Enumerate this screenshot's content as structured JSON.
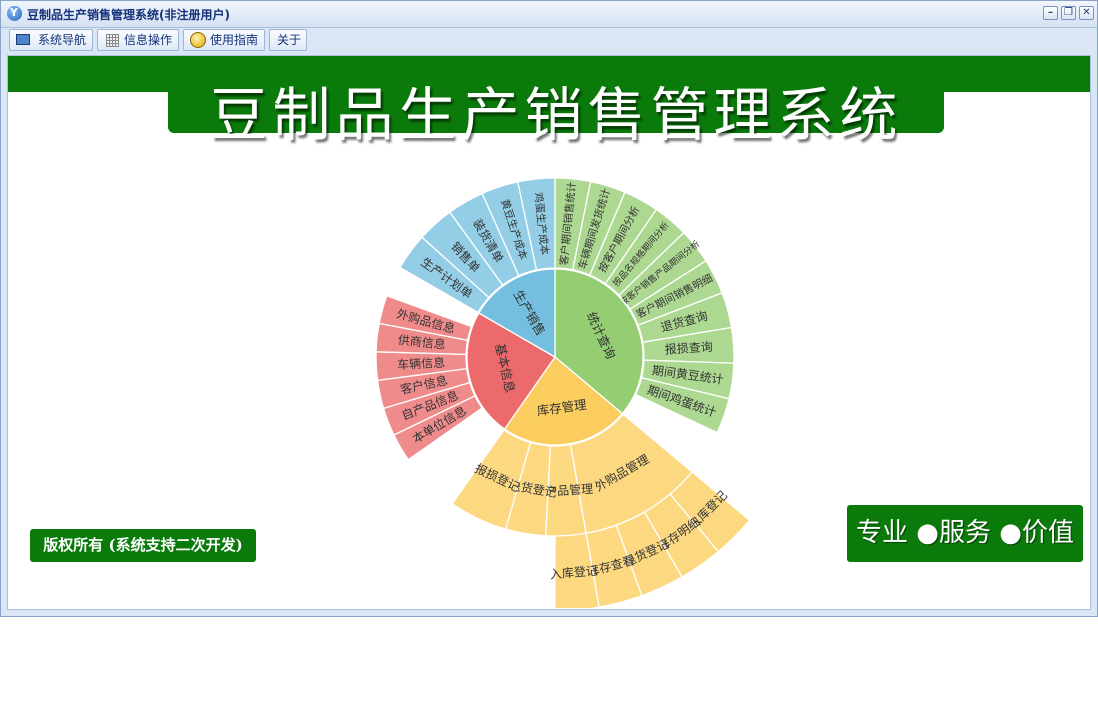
{
  "window": {
    "title": "豆制品生产销售管理系统(非注册用户)",
    "minimize_glyph": "–",
    "restore_glyph": "❐",
    "close_glyph": "✕"
  },
  "toolbar": {
    "tabs": [
      {
        "label": "系统导航",
        "icon": "monitor-icon"
      },
      {
        "label": "信息操作",
        "icon": "grid-icon"
      },
      {
        "label": "使用指南",
        "icon": "help-icon"
      },
      {
        "label": "关于",
        "icon": ""
      }
    ]
  },
  "banner": {
    "title": "豆制品生产销售管理系统"
  },
  "footer": {
    "copyright": "版权所有 (系统支持二次开发)",
    "slogan": "专业 ●服务 ●价值"
  },
  "colors": {
    "brand_green": "#0a7a0a",
    "stats": "#94cd72",
    "stock": "#fbcd5e",
    "basic": "#ec6a6c",
    "production": "#74bfdf"
  },
  "menu": {
    "groups": [
      {
        "label": "统计查询",
        "color": "#94cd72",
        "items": [
          "客户期间销售统计",
          "车辆期间发货统计",
          "按客户期间分析",
          "按品名规格期间分析",
          "按客户销售产品期间分析",
          "客户期间销售明细",
          "退货查询",
          "报损查询",
          "期间黄豆统计",
          "期间鸡蛋统计"
        ]
      },
      {
        "label": "库存管理",
        "color": "#fbcd5e",
        "subgroups": [
          {
            "label": "外购品管理",
            "items": [
              "入库登记",
              "库存明细",
              "退货登记",
              "库存查看",
              "入库登记"
            ]
          },
          {
            "label": "自产品管理",
            "items": []
          },
          {
            "label": "退货登记",
            "items": []
          },
          {
            "label": "报损登记",
            "items": []
          }
        ]
      },
      {
        "label": "基本信息",
        "color": "#ec6a6c",
        "items": [
          "本单位信息",
          "自产品信息",
          "客户信息",
          "车辆信息",
          "供商信息",
          "外购品信息"
        ]
      },
      {
        "label": "生产销售",
        "color": "#74bfdf",
        "items": [
          "生产计划单",
          "销售单",
          "装货清单",
          "黄豆生产成本",
          "鸡蛋生产成本"
        ]
      }
    ]
  }
}
